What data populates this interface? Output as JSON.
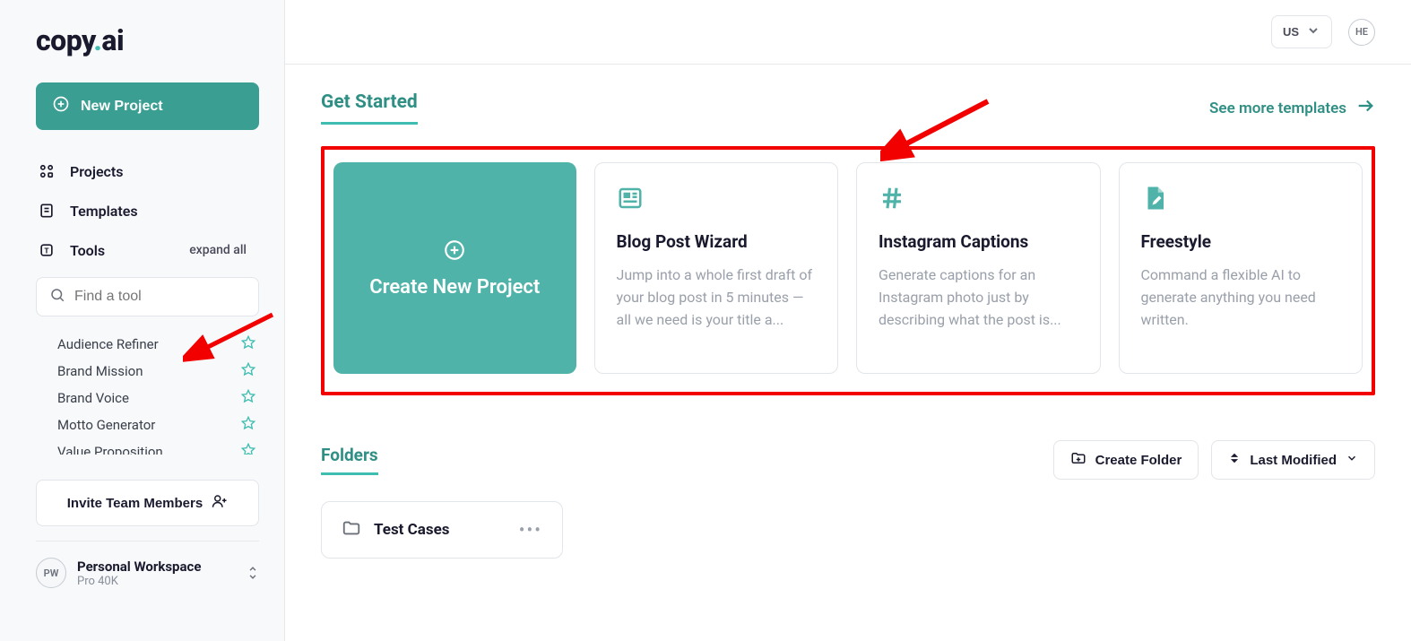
{
  "logo": {
    "prefix": "copy",
    "dot": ".",
    "suffix": "ai"
  },
  "sidebar": {
    "new_project": "New Project",
    "nav": {
      "projects": "Projects",
      "templates": "Templates",
      "tools": "Tools",
      "expand_all": "expand all"
    },
    "search_placeholder": "Find a tool",
    "tools": [
      "Audience Refiner",
      "Brand Mission",
      "Brand Voice",
      "Motto Generator",
      "Value Proposition"
    ],
    "invite": "Invite Team Members",
    "workspace": {
      "initials": "PW",
      "name": "Personal Workspace",
      "plan": "Pro 40K"
    }
  },
  "topbar": {
    "lang": "US",
    "avatar": "HE"
  },
  "get_started": {
    "title": "Get Started",
    "see_more": "See more templates",
    "create_label": "Create New Project",
    "cards": [
      {
        "title": "Blog Post Wizard",
        "desc": "Jump into a whole first draft of your blog post in 5 minutes — all we need is your title a..."
      },
      {
        "title": "Instagram Captions",
        "desc": "Generate captions for an Instagram photo just by describing what the post is..."
      },
      {
        "title": "Freestyle",
        "desc": "Command a flexible AI to generate anything you need written."
      }
    ]
  },
  "folders": {
    "title": "Folders",
    "create": "Create Folder",
    "sort": "Last Modified",
    "items": [
      {
        "name": "Test Cases"
      }
    ]
  }
}
